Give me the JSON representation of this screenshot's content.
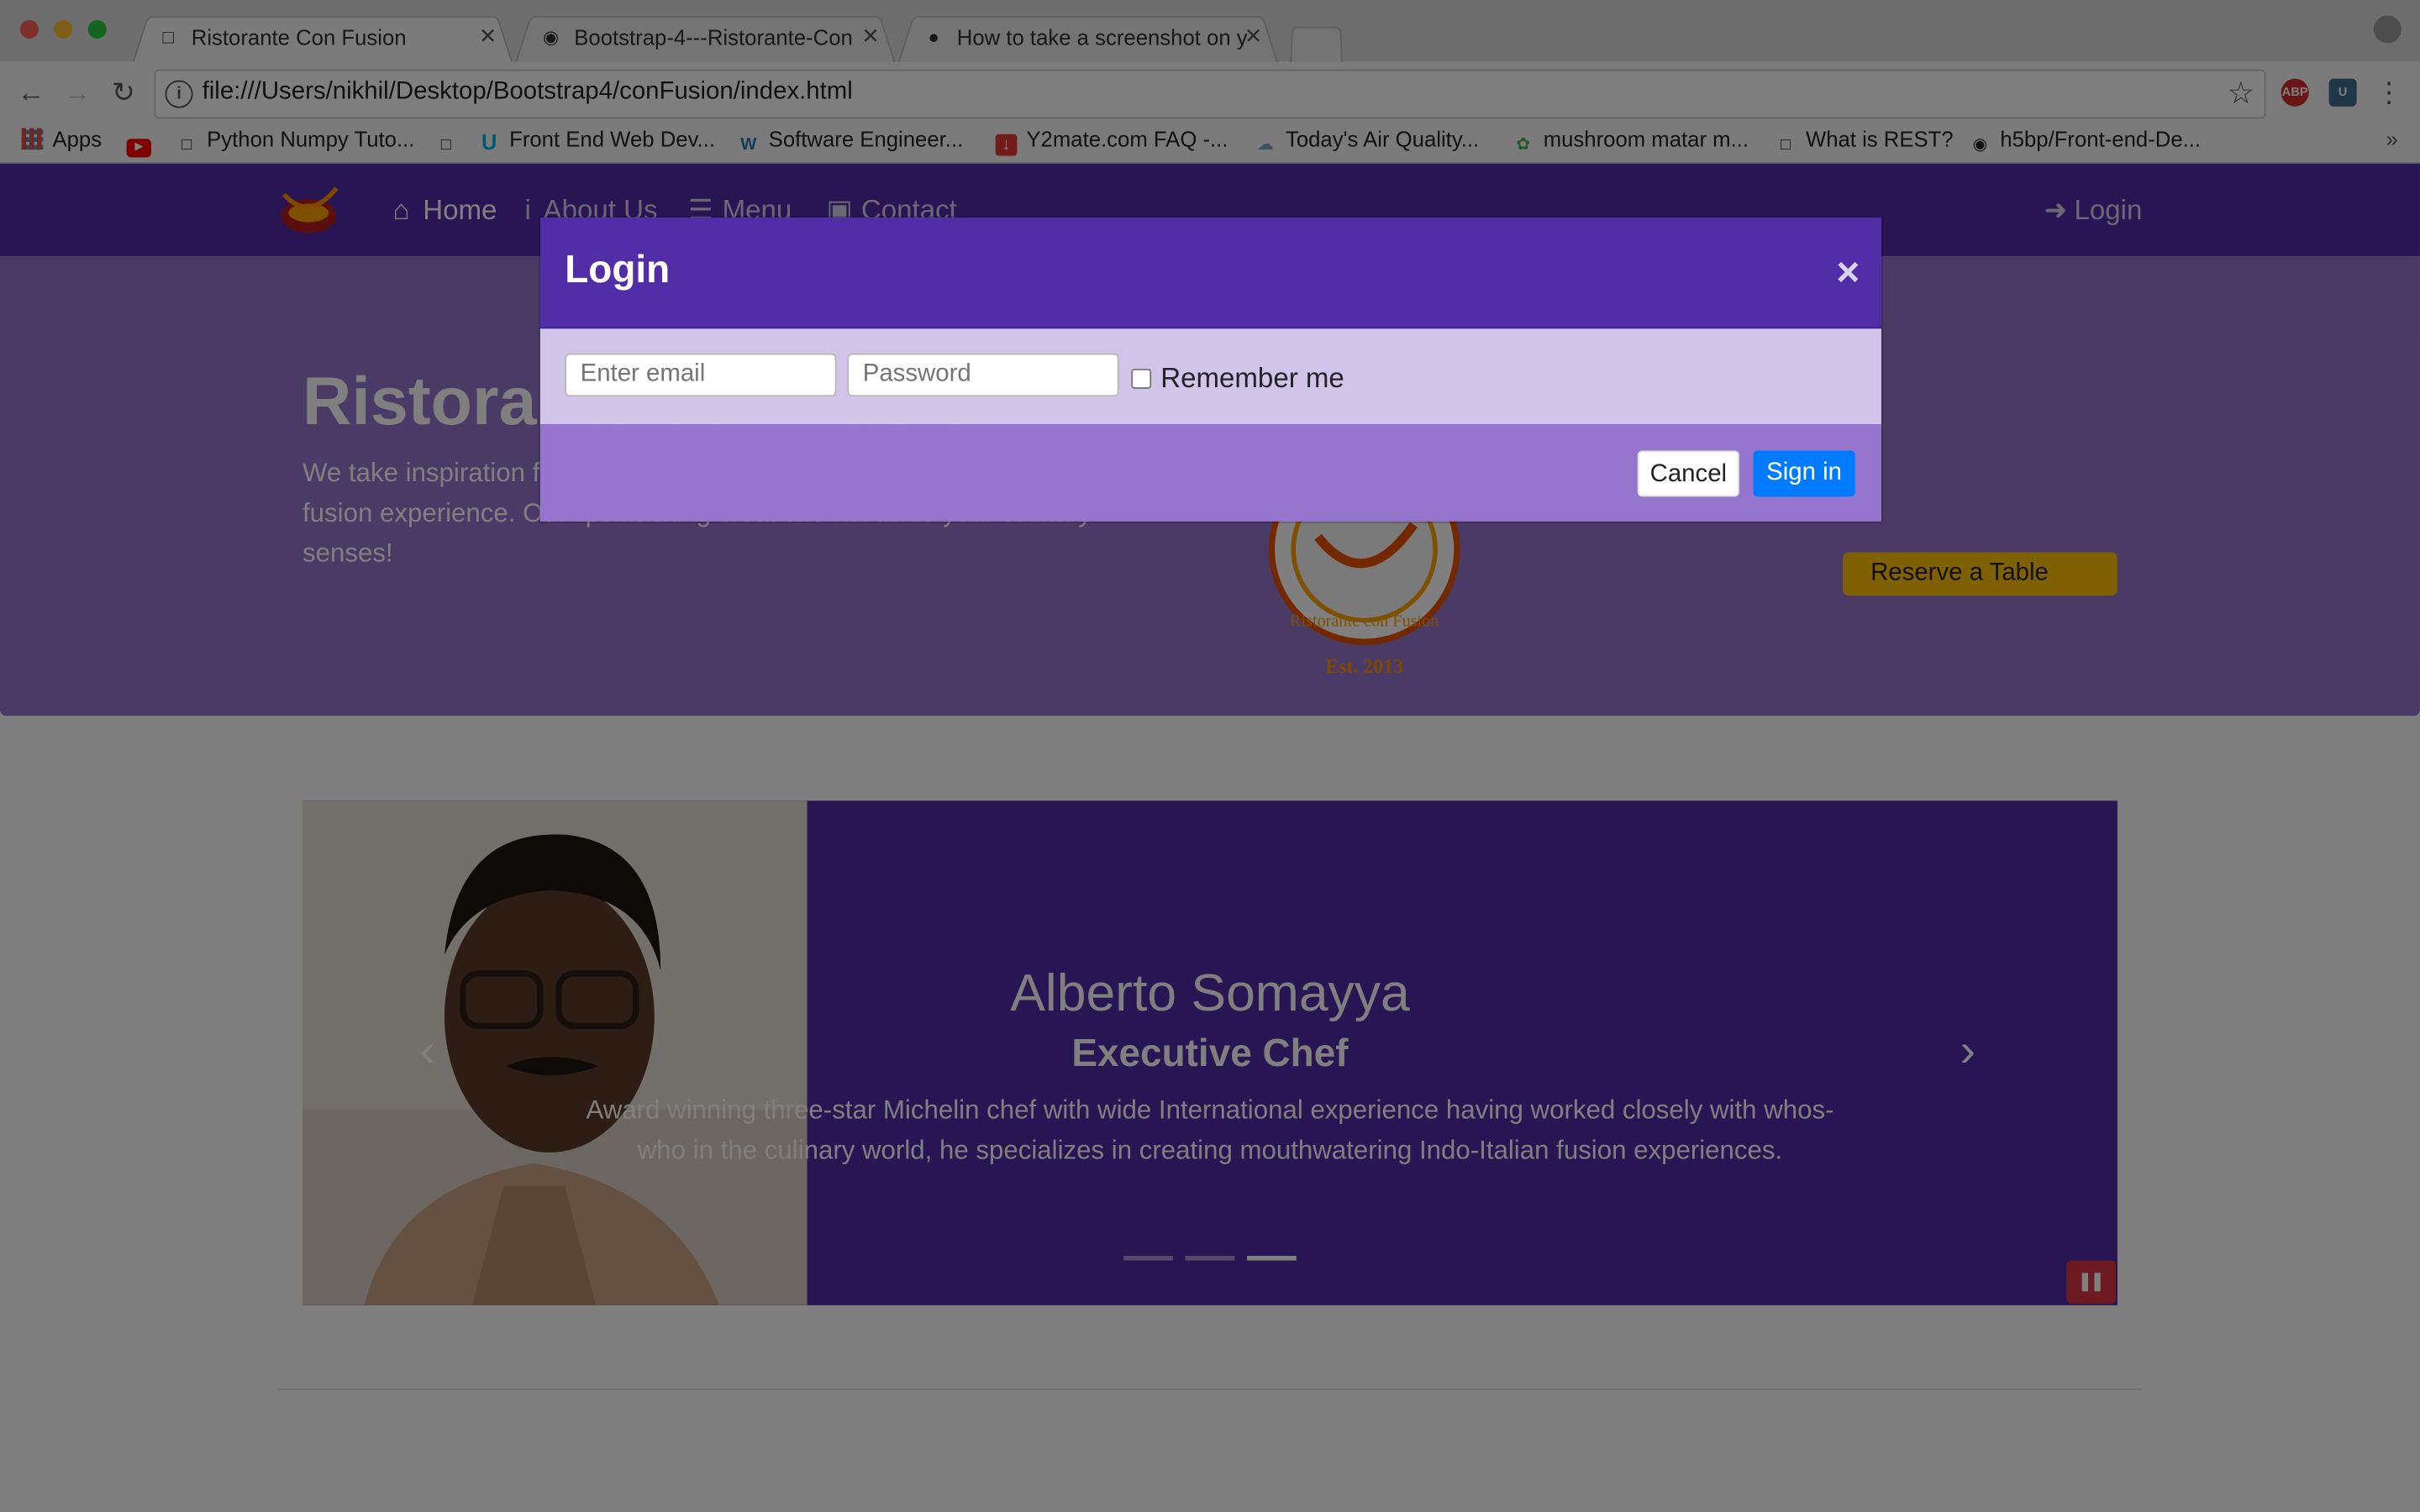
{
  "browser": {
    "tabs": [
      {
        "title": "Ristorante Con Fusion",
        "icon": "page-icon",
        "active": true
      },
      {
        "title": "Bootstrap-4---Ristorante-Con",
        "icon": "github-icon",
        "active": false
      },
      {
        "title": "How to take a screenshot on y",
        "icon": "apple-icon",
        "active": false
      }
    ],
    "address_url": "file:///Users/nikhil/Desktop/Bootstrap4/conFusion/index.html",
    "extensions": [
      {
        "label": "ABP",
        "color": "#d42d2d"
      },
      {
        "label": "U",
        "color": "#3f6e8f"
      }
    ],
    "bookmarks": [
      {
        "label": "Apps",
        "icon": "apps-grid-icon"
      },
      {
        "label": "",
        "icon": "youtube-icon"
      },
      {
        "label": "Python Numpy Tuto...",
        "icon": "page-icon"
      },
      {
        "label": "",
        "icon": "page-icon"
      },
      {
        "label": "Front End Web Dev...",
        "icon": "udacity-icon"
      },
      {
        "label": "Software Engineer...",
        "icon": "w-icon"
      },
      {
        "label": "Y2mate.com FAQ -...",
        "icon": "download-icon"
      },
      {
        "label": "Today's Air Quality...",
        "icon": "cloud-icon"
      },
      {
        "label": "mushroom matar m...",
        "icon": "leaf-icon"
      },
      {
        "label": "What is REST?",
        "icon": "page-icon"
      },
      {
        "label": "h5bp/Front-end-De...",
        "icon": "github-icon"
      }
    ],
    "more_bookmarks": "»"
  },
  "navbar": {
    "links": [
      {
        "label": "Home",
        "icon": "home-icon",
        "active": true
      },
      {
        "label": "About Us",
        "icon": "info-icon",
        "active": false
      },
      {
        "label": "Menu",
        "icon": "list-icon",
        "active": false
      },
      {
        "label": "Contact",
        "icon": "address-card-icon",
        "active": false
      }
    ],
    "login_label": "Login"
  },
  "jumbotron": {
    "title": "Ristorante con Fusion",
    "text": "We take inspiration from the World's best cuisines, and create a unique fusion experience. Our lipsmacking creations will tickle your culinary senses!",
    "reserve_label": "Reserve a Table",
    "logo_text": "Ristorante con Fusion",
    "logo_est": "Est. 2013"
  },
  "carousel": {
    "name": "Alberto Somayya",
    "role": "Executive Chef",
    "description": "Award winning three-star Michelin chef with wide International experience having worked closely with whos-who in the culinary world, he specializes in creating mouthwatering Indo-Italian fusion experiences.",
    "slide_count": 3,
    "active_slide": 3
  },
  "modal": {
    "title": "Login",
    "close_symbol": "×",
    "email_placeholder": "Enter email",
    "password_placeholder": "Password",
    "remember_label": "Remember me",
    "cancel_label": "Cancel",
    "signin_label": "Sign in"
  },
  "colors": {
    "primary": "#512da8",
    "light": "#d1c4e9",
    "medium": "#9575cd",
    "accent": "#ffc107",
    "signin": "#007bff",
    "pause": "#dc3545"
  }
}
